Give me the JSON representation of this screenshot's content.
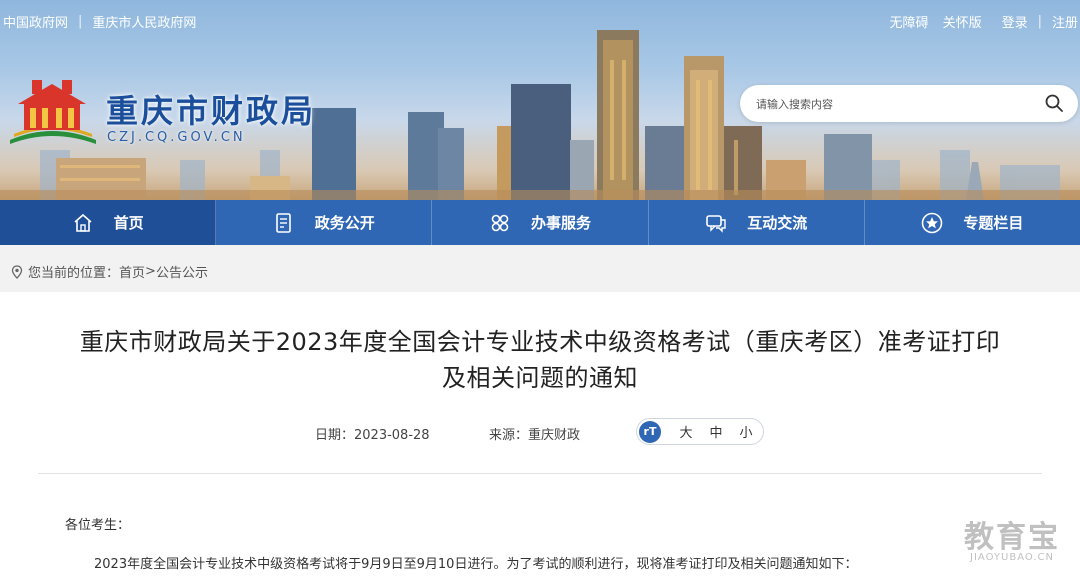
{
  "header": {
    "top_left_links": [
      "中国政府网",
      "重庆市人民政府网"
    ],
    "top_right_links": [
      "无障碍",
      "关怀版",
      "登录",
      "注册"
    ],
    "site_title": "重庆市财政局",
    "site_domain": "CZJ.CQ.GOV.CN",
    "search_placeholder": "请输入搜索内容"
  },
  "nav": {
    "items": [
      {
        "label": "首页",
        "icon": "home-icon"
      },
      {
        "label": "政务公开",
        "icon": "document-icon"
      },
      {
        "label": "办事服务",
        "icon": "service-icon"
      },
      {
        "label": "互动交流",
        "icon": "chat-icon"
      },
      {
        "label": "专题栏目",
        "icon": "star-icon"
      }
    ],
    "active": "首页"
  },
  "breadcrumb": {
    "prefix": "您当前的位置：",
    "home": "首页",
    "separator": ">",
    "current": "公告公示"
  },
  "article": {
    "title_line1": "重庆市财政局关于2023年度全国会计专业技术中级资格考试（重庆考区）准考证打印",
    "title_line2": "及相关问题的通知",
    "date": "日期：2023-08-28",
    "source": "来源：重庆财政",
    "font_sizes": [
      "大",
      "中",
      "小"
    ],
    "font_icon": "rT",
    "salutation": "各位考生：",
    "paragraph": "2023年度全国会计专业技术中级资格考试将于9月9日至9月10日进行。为了考试的顺利进行，现将准考证打印及相关问题通知如下："
  },
  "watermark": {
    "cn": "教育宝",
    "en": "JIAOYUBAO.CN"
  },
  "colors": {
    "nav_bg": "#2f67b5",
    "nav_active": "#1e4f97",
    "title_blue": "#1b4f9c"
  }
}
